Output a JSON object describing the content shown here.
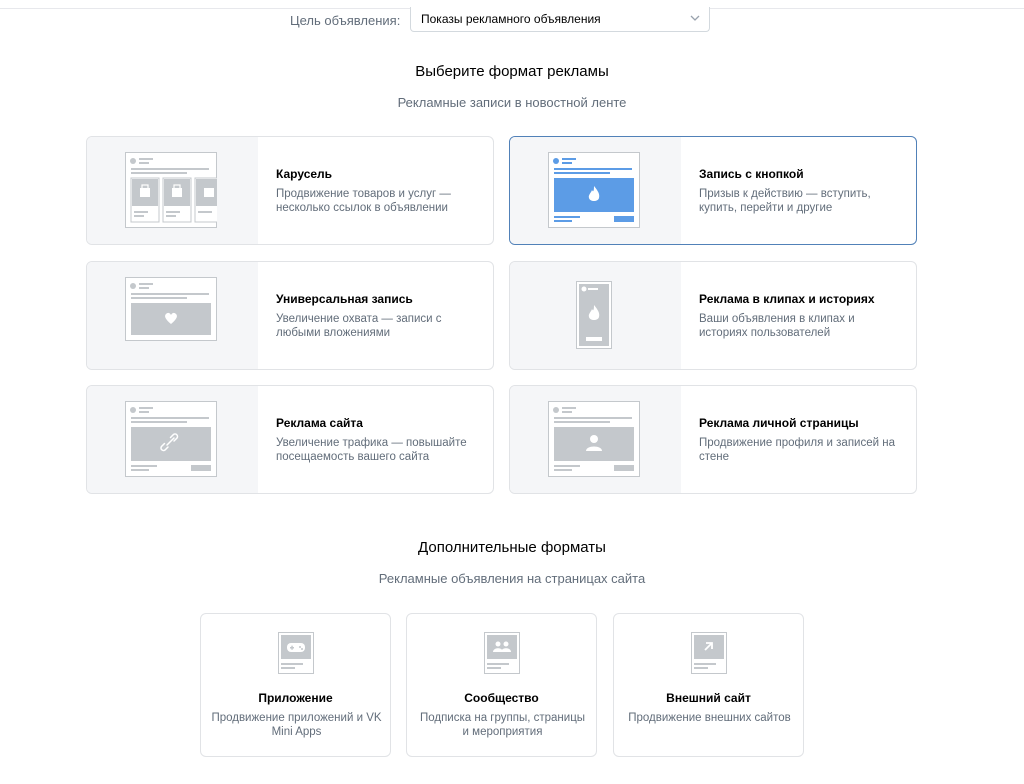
{
  "goal": {
    "label": "Цель объявления:",
    "value": "Показы рекламного объявления"
  },
  "main_section": {
    "title": "Выберите формат рекламы",
    "subtitle": "Рекламные записи в новостной ленте"
  },
  "formats": [
    {
      "title": "Карусель",
      "description": "Продвижение товаров и услуг — несколько ссылок в объявлении",
      "icon": "carousel-preview-icon"
    },
    {
      "title": "Запись с кнопкой",
      "description": "Призыв к действию — вступить, купить, перейти и другие",
      "icon": "button-post-preview-icon",
      "selected": true
    },
    {
      "title": "Универсальная запись",
      "description": "Увеличение охвата — записи с любыми вложениями",
      "icon": "universal-post-preview-icon"
    },
    {
      "title": "Реклама в клипах и историях",
      "description": "Ваши объявления в клипах и историях пользователей",
      "icon": "clips-stories-preview-icon"
    },
    {
      "title": "Реклама сайта",
      "description": "Увеличение трафика — повышайте посещаемость вашего сайта",
      "icon": "site-ad-preview-icon"
    },
    {
      "title": "Реклама личной страницы",
      "description": "Продвижение профиля и записей на стене",
      "icon": "personal-page-preview-icon"
    }
  ],
  "extra_section": {
    "title": "Дополнительные форматы",
    "subtitle": "Рекламные объявления на страницах сайта"
  },
  "extra_formats": [
    {
      "title": "Приложение",
      "description": "Продвижение приложений и VK Mini Apps",
      "icon": "gamepad-icon"
    },
    {
      "title": "Сообщество",
      "description": "Подписка на группы, страницы и мероприятия",
      "icon": "community-icon"
    },
    {
      "title": "Внешний сайт",
      "description": "Продвижение внешних сайтов",
      "icon": "external-link-icon"
    }
  ],
  "colors": {
    "accent": "#5181b8",
    "thumb_blue": "#5c9ce6",
    "thumb_gray": "#c4c8cc"
  }
}
